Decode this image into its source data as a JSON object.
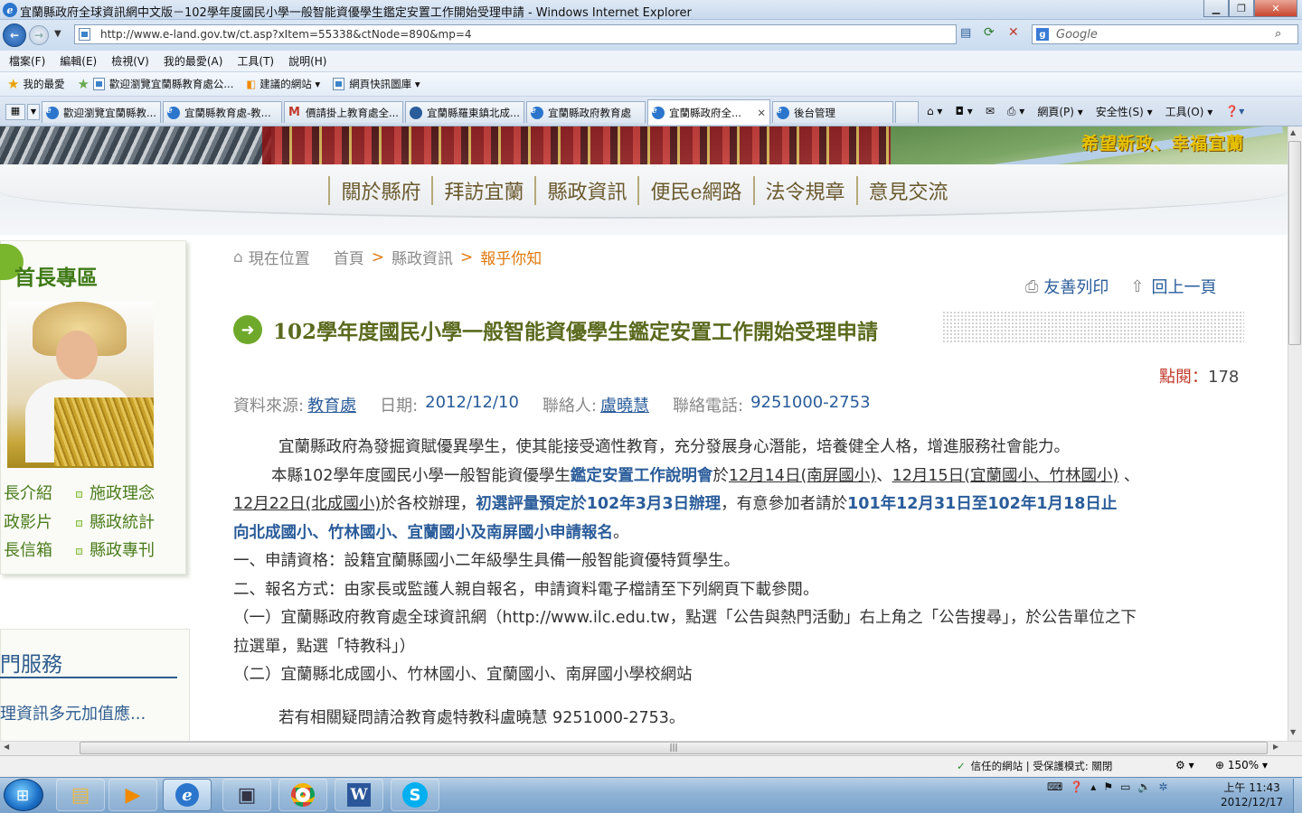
{
  "window": {
    "title": "宜蘭縣政府全球資訊網中文版－102學年度國民小學一般智能資優學生鑑定安置工作開始受理申請 - Windows Internet Explorer"
  },
  "address_bar": {
    "url": "http://www.e-land.gov.tw/ct.asp?xItem=55338&ctNode=890&mp=4",
    "search_placeholder": "Google"
  },
  "menu": [
    "檔案(F)",
    "編輯(E)",
    "檢視(V)",
    "我的最愛(A)",
    "工具(T)",
    "說明(H)"
  ],
  "favorites": [
    "我的最愛",
    "歡迎瀏覽宜蘭縣教育處公...",
    "建議的網站 ▾",
    "網頁快訊圖庫 ▾"
  ],
  "tabs": [
    {
      "label": "歡迎瀏覽宜蘭縣教..."
    },
    {
      "label": "宜蘭縣教育處-教..."
    },
    {
      "label": "價請掛上教育處全..."
    },
    {
      "label": "宜蘭縣羅東鎮北成..."
    },
    {
      "label": "宜蘭縣政府教育處"
    },
    {
      "label": "宜蘭縣政府全..."
    },
    {
      "label": "後台管理"
    }
  ],
  "command_bar": [
    "網頁(P) ▾",
    "安全性(S) ▾",
    "工具(O) ▾"
  ],
  "banner": {
    "slogan": "希望新政、幸福宜蘭"
  },
  "main_nav": [
    "關於縣府",
    "拜訪宜蘭",
    "縣政資訊",
    "便民e網路",
    "法令規章",
    "意見交流"
  ],
  "sidebar": {
    "title": "首長專區",
    "links_left": [
      "長介紹",
      "政影片",
      "長信箱"
    ],
    "links_right": [
      "施政理念",
      "縣政統計",
      "縣政專刊"
    ],
    "service_title": "門服務",
    "service_item": "理資訊多元加值應..."
  },
  "breadcrumb": {
    "label": "現在位置",
    "items": [
      "首頁",
      "縣政資訊",
      "報乎你知"
    ],
    "separator": ">"
  },
  "tools": {
    "print": "友善列印",
    "back": "回上一頁"
  },
  "article": {
    "title": "102學年度國民小學一般智能資優學生鑑定安置工作開始受理申請",
    "views_label": "點閱：",
    "views": "178",
    "source_label": "資料來源:",
    "source": "教育處",
    "date_label": "日期:",
    "date": "2012/12/10",
    "contact_label": "聯絡人:",
    "contact": "盧曉慧",
    "phone_label": "聯絡電話:",
    "phone": "9251000-2753",
    "p1": "宜蘭縣政府為發掘資賦優異學生，使其能接受適性教育，充分發展身心潛能，培養健全人格，增進服務社會能力。",
    "p2a": "本縣102學年度國民小學一般智能資優學生",
    "p2b": "鑑定安置工作說明會",
    "p2c": "於",
    "p2d": "12月14日(南屏國小)",
    "p2e": "、",
    "p2f": "12月15日(宜蘭國小、竹林國小)",
    "p2g": " 、",
    "p3a": "12月22日(北成國小)",
    "p3b": "於各校辦理，",
    "p3c": "初選評量預定於102年3月3日辦理",
    "p3d": "，有意參加者請於",
    "p3e": "101年12月31日至102年1月18日止",
    "p4a": "向北成國小、竹林國小、宜蘭國小及南屏國小申請報名",
    "p4b": "。",
    "p5": "一、申請資格：設籍宜蘭縣國小二年級學生具備一般智能資優特質學生。",
    "p6": "二、報名方式：由家長或監護人親自報名，申請資料電子檔請至下列網頁下載參閱。",
    "p7": "（一）宜蘭縣政府教育處全球資訊網（http://www.ilc.edu.tw，點選「公告與熱門活動」右上角之「公告搜尋」，於公告單位之下",
    "p8": "拉選單，點選「特教科」）",
    "p9": "（二）宜蘭縣北成國小、竹林國小、宜蘭國小、南屏國小學校網站",
    "p10": "若有相關疑問請洽教育處特教科盧曉慧 9251000-2753。"
  },
  "status_bar": {
    "zone": "信任的網站 | 受保護模式: 關閉",
    "zoom": "150%"
  },
  "taskbar": {
    "time": "上午 11:43",
    "date": "2012/12/17"
  },
  "colors": {
    "accent_green": "#6fa92b",
    "link_blue": "#2a5c9a",
    "crumb_orange": "#e07a10",
    "views_red": "#c0392b"
  }
}
